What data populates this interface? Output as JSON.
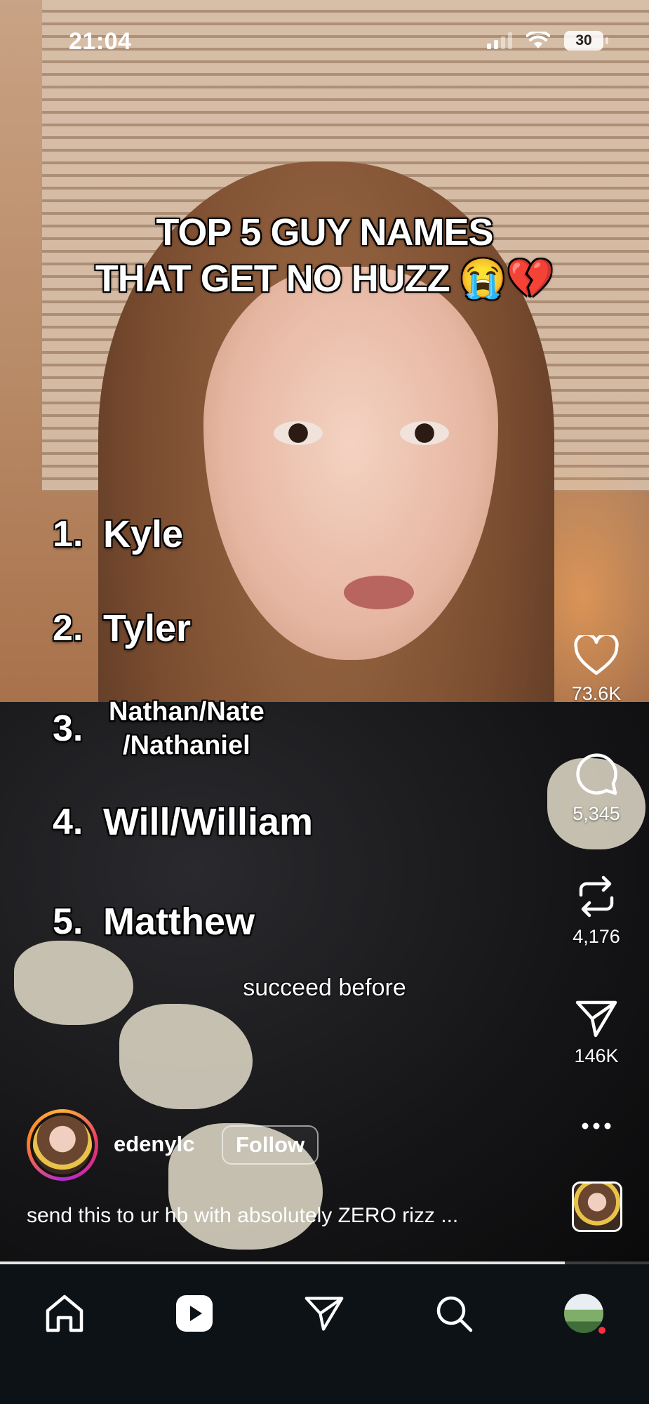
{
  "status_bar": {
    "time": "21:04",
    "battery": "30",
    "icons": [
      "signal-icon",
      "wifi-icon",
      "battery-icon"
    ]
  },
  "overlay": {
    "title_line1": "TOP 5 GUY NAMES",
    "title_line2": "THAT GET NO HUZZ",
    "title_emoji": "😭💔",
    "list": [
      {
        "num": "1.",
        "name": "Kyle"
      },
      {
        "num": "2.",
        "name": "Tyler"
      },
      {
        "num": "3.",
        "name_line1": "Nathan/Nate",
        "name_line2": "/Nathaniel"
      },
      {
        "num": "4.",
        "name": "Will/William"
      },
      {
        "num": "5.",
        "name": "Matthew"
      }
    ],
    "subtitle": "succeed before"
  },
  "actions": {
    "likes": "73.6K",
    "comments": "5,345",
    "reposts": "4,176",
    "shares": "146K",
    "icons": [
      "heart-icon",
      "comment-icon",
      "repost-icon",
      "share-icon",
      "more-icon"
    ]
  },
  "post": {
    "username": "edenylc",
    "follow_label": "Follow",
    "caption": "send this to ur hb with absolutely ZERO rizz ..."
  },
  "progress": 0.87,
  "nav": {
    "items": [
      "home-icon",
      "reels-icon",
      "direct-icon",
      "search-icon",
      "profile-avatar"
    ],
    "profile_notification": true
  },
  "colors": {
    "nav_background": "#0d1217",
    "notification_dot": "#ff2d3d",
    "story_ring": [
      "#ffb13b",
      "#e9306b",
      "#b52bd1"
    ]
  }
}
